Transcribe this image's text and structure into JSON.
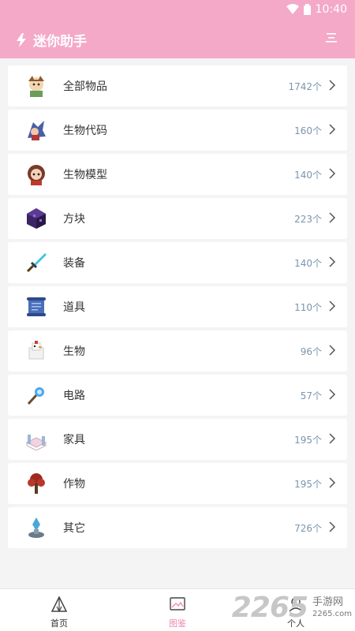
{
  "status_bar": {
    "time": "10:40",
    "icons": [
      "wifi-icon",
      "battery-icon"
    ]
  },
  "app_bar": {
    "title": "迷你助手",
    "lightning_icon": "lightning-icon",
    "menu_icon": "menu-icon"
  },
  "colors": {
    "accent": "#f4a9c8",
    "active_tab": "#f08ab6",
    "count_text": "#7a95b0"
  },
  "categories": [
    {
      "label": "全部物品",
      "count": "1742个",
      "icon": "character-icon"
    },
    {
      "label": "生物代码",
      "count": "160个",
      "icon": "character-icon"
    },
    {
      "label": "生物模型",
      "count": "140个",
      "icon": "character-icon"
    },
    {
      "label": "方块",
      "count": "223个",
      "icon": "block-icon"
    },
    {
      "label": "装备",
      "count": "140个",
      "icon": "sword-icon"
    },
    {
      "label": "道具",
      "count": "110个",
      "icon": "scroll-icon"
    },
    {
      "label": "生物",
      "count": "96个",
      "icon": "chicken-icon"
    },
    {
      "label": "电路",
      "count": "57个",
      "icon": "wand-icon"
    },
    {
      "label": "家具",
      "count": "195个",
      "icon": "bed-icon"
    },
    {
      "label": "作物",
      "count": "195个",
      "icon": "tree-icon"
    },
    {
      "label": "其它",
      "count": "726个",
      "icon": "crystal-icon"
    }
  ],
  "tabbar": {
    "tabs": [
      {
        "label": "首页",
        "icon": "tent-icon",
        "active": false
      },
      {
        "label": "图鉴",
        "icon": "image-icon",
        "active": true
      },
      {
        "label": "个人",
        "icon": "person-icon",
        "active": false
      }
    ]
  },
  "watermark": {
    "number": "2265",
    "text": "手游网",
    "domain": "2265.com"
  }
}
